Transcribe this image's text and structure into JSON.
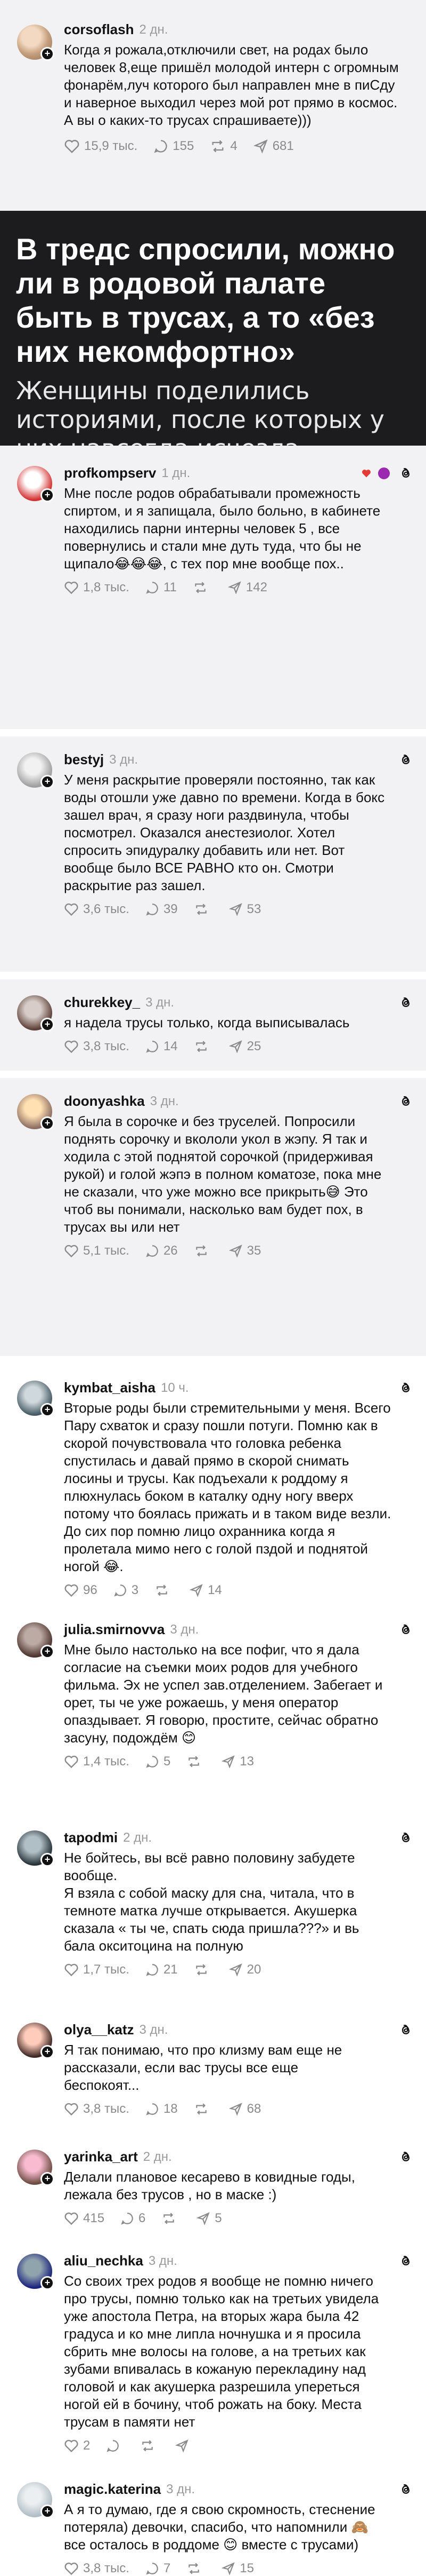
{
  "top_post": {
    "username": "corsoflash",
    "time": "2 дн.",
    "text": "Когда я рожала,отключили свет, на родах было человек 8,еще  пришёл  молодой интерн  с огромным фонарём,луч которого  был направлен  мне в пиСду и наверное выходил через  мой рот  прямо  в космос. А вы о каких-то трусах спрашиваете)))",
    "likes": "15,9 тыс.",
    "replies": "155",
    "reposts": "4",
    "shares": "681"
  },
  "banner": {
    "title": "В тредс спросили, можно ли в родовой палате быть в трусах, а то «без них некомфортно»",
    "subtitle": "Женщины поделились историями, после которых у них навсегда исчезла стеснительность"
  },
  "posts": [
    {
      "username": "profkompserv",
      "time": "1 дн.",
      "text": "Мне после родов обрабатывали промежность спиртом, и я запищала, было больно, в кабинете находились парни интерны человек 5 , все повернулись и стали мне дуть туда, что бы не щипало😂😂😂, с тех пор мне вообще пох..",
      "likes": "1,8 тыс.",
      "replies": "11",
      "reposts": "",
      "shares": "142"
    },
    {
      "username": "bestyj",
      "time": "3 дн.",
      "text": "У меня раскрытие проверяли постоянно, так как воды отошли уже давно по времени. Когда в бокс зашел врач, я сразу ноги раздвинула, чтобы посмотрел. Оказался анестезиолог. Хотел спросить эпидуралку добавить или нет. Вот вообще было ВСЕ РАВНО кто он. Смотри раскрытие раз зашел.",
      "likes": "3,6 тыс.",
      "replies": "39",
      "reposts": "",
      "shares": "53"
    },
    {
      "username": "churekkey_",
      "time": "3 дн.",
      "text": "я надела трусы только, когда выписывалась",
      "likes": "3,8 тыс.",
      "replies": "14",
      "reposts": "",
      "shares": "25"
    },
    {
      "username": "doonyashka",
      "time": "3 дн.",
      "text": "Я была в сорочке и без труселей. Попросили поднять сорочку и вкололи укол в жэпу. Я так и ходила с этой поднятой сорочкой (придерживая рукой) и голой жэпэ в полном коматозе, пока мне не сказали, что уже можно все прикрыть😅 Это чтоб вы понимали, насколько вам будет пох, в трусах вы или нет",
      "likes": "5,1 тыс.",
      "replies": "26",
      "reposts": "",
      "shares": "35"
    },
    {
      "username": "kymbat_aisha",
      "time": "10 ч.",
      "text": "Вторые роды были стремительными у меня. Всего Пару схваток и сразу пошли потуги. Помню как в скорой почувствовала что головка ребенка спустилась и давай прямо в скорой снимать лосины  и трусы. Как подъехали к роддому я плюхнулась боком в каталку одну ногу вверх потому что боялась прижать и в таком виде везли. До сих пор помню  лицо охранника когда я пролетала мимо него с голой пздой и поднятой ногой 😂.",
      "likes": "96",
      "replies": "3",
      "reposts": "",
      "shares": "14"
    },
    {
      "username": "julia.smirnovva",
      "time": "3 дн.",
      "text": "Мне было настолько на все пофиг, что я дала согласие на съемки моих родов для учебного фильма. Эх не успел зав.отделением. Забегает и орет, ты че уже рожаешь, у меня оператор опаздывает. Я говорю, простите, сейчас обратно засуну, подождём 😊",
      "likes": "1,4 тыс.",
      "replies": "5",
      "reposts": "",
      "shares": "13"
    },
    {
      "username": "tapodmi",
      "time": "2 дн.",
      "text": "Не бойтесь, вы всё равно половину забудете вообще.\nЯ взяла с собой маску для сна, читала, что в темноте матка лучше открывается. Акушерка сказала « ты че, спать сюда пришла???» и вь   бала окситоцина на полную",
      "likes": "1,7 тыс.",
      "replies": "21",
      "reposts": "",
      "shares": "20"
    },
    {
      "username": "olya__katz",
      "time": "3 дн.",
      "text": "Я так понимаю, что про клизму вам еще не рассказали, если вас трусы все еще беспокоят...",
      "likes": "3,8 тыс.",
      "replies": "18",
      "reposts": "",
      "shares": "68"
    },
    {
      "username": "yarinka_art",
      "time": "2 дн.",
      "text": "Делали плановое кесарево в ковидные годы, лежала без трусов , но в маске :)",
      "likes": "415",
      "replies": "6",
      "reposts": "",
      "shares": "5"
    },
    {
      "username": "aliu_nechka",
      "time": "3 дн.",
      "text": "Со своих трех родов я вообще не помню ничего про трусы, помню только как на третьих увидела уже апостола Петра, на вторых жара была 42 градуса и ко мне липла ночнушка и я просила сбрить мне волосы на голове, а на третьих как зубами впивалась в кожаную перекладину над головой и как акушерка разрешила упереться ногой ей в бочину, чтоб рожать на боку. Места трусам в памяти нет",
      "likes": "2",
      "replies": "",
      "reposts": "",
      "shares": ""
    },
    {
      "username": "magic.katerina",
      "time": "3 дн.",
      "text": "А я то думаю, где я свою скромность, стеснение потеряла) девочки, спасибо, что напомнили 🙈 все осталось в роддоме 😊 вместе с трусами)",
      "likes": "3,8 тыс.",
      "replies": "7",
      "reposts": "",
      "shares": "15"
    }
  ],
  "colors": {
    "banner_bg": "#1c1c1e",
    "alt_bg": "#f2f2f4",
    "muted": "#8a8a8a",
    "heart_red": "#e53935"
  },
  "icons": {
    "like": "heart-icon",
    "reply": "comment-icon",
    "repost": "repost-icon",
    "share": "share-icon",
    "follow": "plus-icon",
    "threads": "threads-logo-icon"
  }
}
